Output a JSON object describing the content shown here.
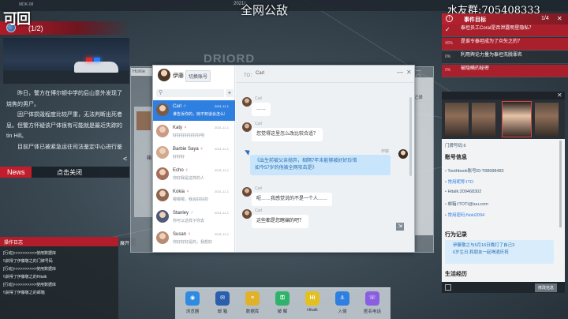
{
  "top": {
    "mdk": "MDK-08",
    "date_text": "2021/",
    "title": "全网公敌",
    "watermark": "水友群:705408333"
  },
  "news": {
    "logo": "可回",
    "count": "(1/2)",
    "paragraphs": [
      "昨日，警方在博尔顿中学的后山意外发现了",
      "烧焦的男尸。",
      "因尸体损毁程度比较严重，无法判断出死者",
      "息。但警方怀疑该尸体很有可能就是最近失踪的",
      "tin Hill。",
      "目前尸体已被紧急运往司法鉴定中心进行鉴"
    ],
    "tag": "News",
    "close": "点击关闭",
    "arrow": "<"
  },
  "oplog": {
    "title": "操作日志",
    "expand": "展开",
    "lines": [
      "[行动]>>>>>>>>>>使用数据库",
      "\\\\获得了伊藤敬之的门牌号码",
      "[行动]>>>>>>>>>>使用数据库",
      "\\\\获得了伊藤敬之的Hitalk",
      "[行动]>>>>>>>>>>使用数据库",
      "\\\\获得了伊藤敬之的邮箱"
    ]
  },
  "background_window": {
    "tab": "Home",
    "record_label": "记录",
    "box_char": "箱"
  },
  "chat": {
    "user_name": "伊藤",
    "switch_label": "切换账号",
    "add": "+",
    "to_label": "TO：",
    "to_name": "Carl",
    "minimize": "—",
    "close": "✕",
    "contacts": [
      {
        "name": "Carl",
        "badge": "♂",
        "badge_color": "#5aa2ff",
        "msg": "谁告诉你的，她不知道会怎么样",
        "date": "2021-11-1",
        "avatar": "#7b5b48",
        "active": true
      },
      {
        "name": "Katy",
        "badge": "♀",
        "badge_color": "#e6344a",
        "msg": "好好好好好好好吧",
        "date": "2021-11-1",
        "avatar": "#c99b86",
        "active": false
      },
      {
        "name": "Barbie Saya",
        "badge": "♀",
        "badge_color": "#e6344a",
        "msg": "好好好",
        "date": "2021-11-1",
        "avatar": "#d1a98f",
        "active": false
      },
      {
        "name": "Echo",
        "badge": "♀",
        "badge_color": "#e6344a",
        "msg": "你好我是这样的人",
        "date": "2021-11-1",
        "avatar": "#a36f5b",
        "active": false
      },
      {
        "name": "Kokia",
        "badge": "♀",
        "badge_color": "#e6344a",
        "msg": "嗯嗯嗯，我会好好的",
        "date": "2021-11-1",
        "avatar": "#8d6650",
        "active": false
      },
      {
        "name": "Stanley",
        "badge": "♂",
        "badge_color": "#5aa2ff",
        "msg": "你可以这样子你去",
        "date": "2021-11-1",
        "avatar": "#4f5b78",
        "active": false
      },
      {
        "name": "Susan",
        "badge": "♀",
        "badge_color": "#e6344a",
        "msg": "你好好好是的，我想好",
        "date": "2021-11-1",
        "avatar": "#b88b73",
        "active": false
      }
    ],
    "messages": [
      {
        "from": "Carl",
        "side": "left",
        "text": "……"
      },
      {
        "from": "Carl",
        "side": "left",
        "text": "您觉得这里怎么改比较合适？"
      },
      {
        "from": "伊藤",
        "side": "right",
        "text": "《出生前被父亲抛弃，相隔7年未能够被好好珍惜\n如今57岁的他被全网攻击是》"
      },
      {
        "from": "Carl",
        "side": "left",
        "text": "呃……我感觉说的不是一个人……"
      },
      {
        "from": "Carl",
        "side": "left",
        "text": "这些都是您瞎编的吧？"
      }
    ]
  },
  "objectives": {
    "title": "事件目标",
    "counter": "1/4",
    "close": "✕",
    "items": [
      {
        "pct": "✓",
        "text": "泰坦员工Coral是否泄露明星隐私？",
        "done": true,
        "highlight": true
      },
      {
        "pct": "40%",
        "text": "是谁令泰坦成为了众矢之的？",
        "done": false,
        "highlight": true
      },
      {
        "pct": "0%",
        "text": "利用舆论力量为泰坦洗脱罪名",
        "done": false,
        "highlight": false
      },
      {
        "pct": "0%",
        "text": "被隐瞒的秘密",
        "done": false,
        "highlight": true
      }
    ]
  },
  "profile": {
    "door": "门牌号码:6",
    "account_title": "账号信息",
    "accounts": [
      {
        "text": "Toothbook账号ID:T88688483",
        "link": false
      },
      {
        "text": "常用昵称:ITO",
        "link": true
      },
      {
        "text": "Hitalk:209468302",
        "link": false
      },
      {
        "text": "邮箱:ITOTI@iuu.com",
        "link": false
      },
      {
        "text": "常用密码:Noki2094",
        "link": true
      }
    ],
    "behavior_title": "行为记录",
    "behavior_text": "伊藤敬之与5月16日晚打了自己3\n6岁生日,和朋友一起喝酒庆祝",
    "life_title": "生活经历",
    "foot_button": "修改信息"
  },
  "dock": [
    {
      "label": "浏览器",
      "icon": "browser-icon",
      "color": "#2f8be0",
      "glyph": "◉"
    },
    {
      "label": "邮 箱",
      "icon": "mail-icon",
      "color": "#2b5fae",
      "glyph": "✉"
    },
    {
      "label": "数据库",
      "icon": "database-icon",
      "color": "#e0b12a",
      "glyph": "≡"
    },
    {
      "label": "破 解",
      "icon": "crack-icon",
      "color": "#2fb36a",
      "glyph": "⚿"
    },
    {
      "label": "Hitalk",
      "icon": "hitalk-icon",
      "color": "#e3c020",
      "glyph": "Hi"
    },
    {
      "label": "入侵",
      "icon": "hook-icon",
      "color": "#2f7fe0",
      "glyph": "⚓"
    },
    {
      "label": "匿名电话",
      "icon": "phone-icon",
      "color": "#8a5ee0",
      "glyph": "☏"
    }
  ]
}
